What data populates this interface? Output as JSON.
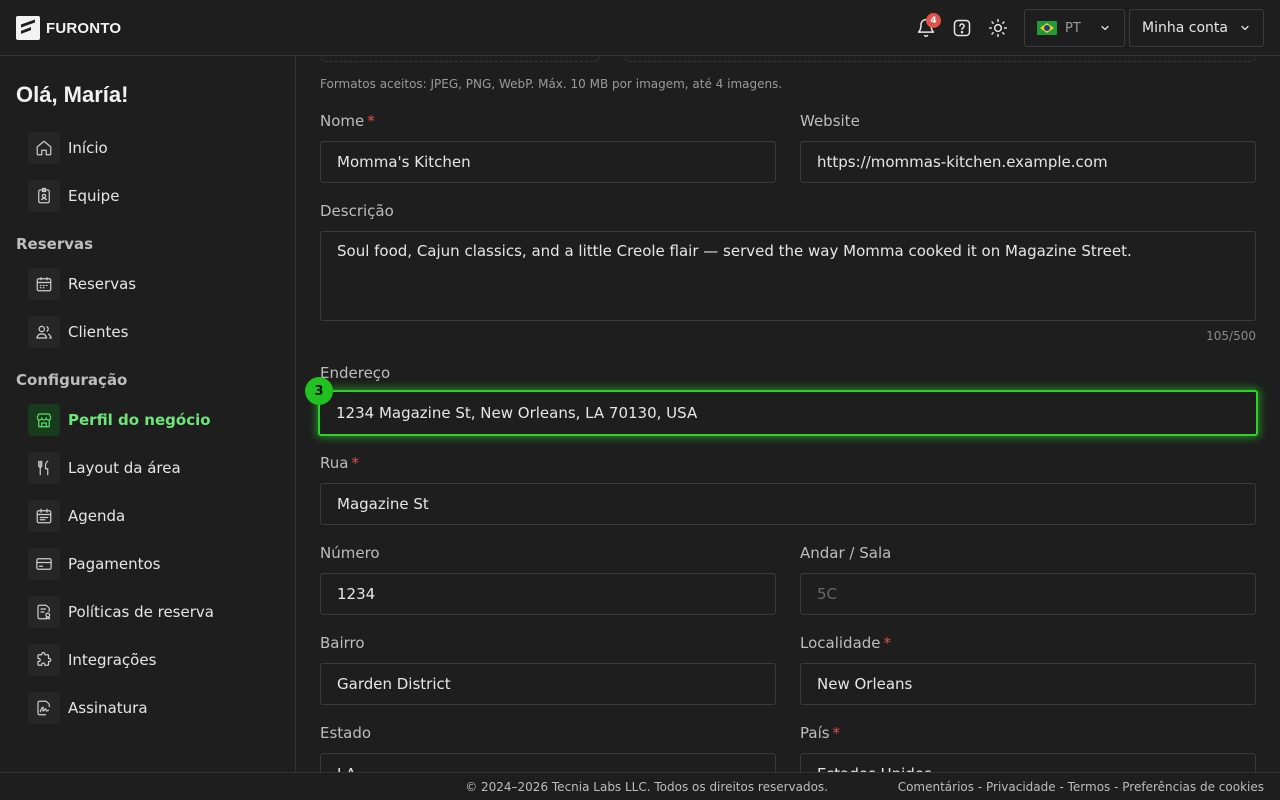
{
  "brand": {
    "name": "FURONTO"
  },
  "topbar": {
    "notifications_count": "4",
    "language": "PT",
    "account_label": "Minha conta"
  },
  "sidebar": {
    "greeting": "Olá, María!",
    "items_top": [
      {
        "label": "Início"
      },
      {
        "label": "Equipe"
      }
    ],
    "section_reservas": "Reservas",
    "items_reservas": [
      {
        "label": "Reservas"
      },
      {
        "label": "Clientes"
      }
    ],
    "section_config": "Configuração",
    "items_config": [
      {
        "label": "Perfil do negócio"
      },
      {
        "label": "Layout da área"
      },
      {
        "label": "Agenda"
      },
      {
        "label": "Pagamentos"
      },
      {
        "label": "Políticas de reserva"
      },
      {
        "label": "Integrações"
      },
      {
        "label": "Assinatura"
      }
    ]
  },
  "form": {
    "image_hint": "Formatos aceitos: JPEG, PNG, WebP. Máx. 10 MB por imagem, até 4 imagens.",
    "name_label": "Nome",
    "name_value": "Momma's Kitchen",
    "website_label": "Website",
    "website_value": "https://mommas-kitchen.example.com",
    "description_label": "Descrição",
    "description_value": "Soul food, Cajun classics, and a little Creole flair — served the way Momma cooked it on Magazine Street.",
    "description_counter": "105/500",
    "address_label": "Endereço",
    "address_value": "1234 Magazine St, New Orleans, LA 70130, USA",
    "step_marker": "3",
    "street_label": "Rua",
    "street_value": "Magazine St",
    "number_label": "Número",
    "number_value": "1234",
    "floor_label": "Andar / Sala",
    "floor_placeholder": "5C",
    "neighborhood_label": "Bairro",
    "neighborhood_value": "Garden District",
    "locality_label": "Localidade",
    "locality_value": "New Orleans",
    "state_label": "Estado",
    "state_value": "LA",
    "country_label": "País",
    "country_value": "Estados Unidos",
    "required_mark": "*"
  },
  "footer": {
    "copyright": "© 2024–2026 Tecnia Labs LLC. Todos os direitos reservados.",
    "links": [
      "Comentários",
      "Privacidade",
      "Termos",
      "Preferências de cookies"
    ],
    "separator": " - "
  },
  "colors": {
    "accent": "#2bd42b",
    "active_text": "#6fe57a",
    "badge": "#e0524b",
    "background": "#1e1e1e"
  }
}
